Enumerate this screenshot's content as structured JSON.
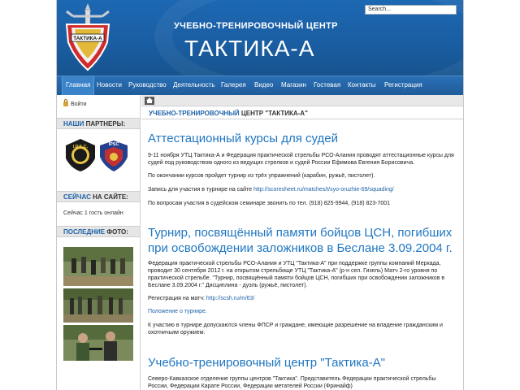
{
  "header": {
    "subtitle": "УЧЕБНО-ТРЕНИРОВОЧНЫЙ ЦЕНТР",
    "title": "ТАКТИКА-А",
    "logo_text": "ТАКТИКА-А",
    "search_placeholder": "Search..."
  },
  "nav": {
    "items": [
      "Главная",
      "Новости",
      "Руководство",
      "Деятельность",
      "Галерея",
      "Видео",
      "Магазин",
      "Гостевая",
      "Контакты",
      "Регистрация"
    ],
    "active": "Главная"
  },
  "sidebar": {
    "login_label": "Войти",
    "partners_title_hl": "НАШИ",
    "partners_title_rest": "ПАРТНЕРЫ:",
    "partner1_text": "I.P.S.C.",
    "partner2_text": "IPSC",
    "online_title_hl": "СЕЙЧАС",
    "online_title_rest": "НА САЙТЕ:",
    "online_text": "Сейчас 1 гость онлайн",
    "photos_title_hl": "ПОСЛЕДНИЕ",
    "photos_title_rest": "ФОТО:"
  },
  "content": {
    "page_label_hl": "УЧЕБНО-ТРЕНИРОВОЧНЫЙ",
    "page_label_rest": "ЦЕНТР \"ТАКТИКА-А\"",
    "articles": [
      {
        "title": "Аттестационный курсы для судей",
        "p1": "9-11 ноября УТЦ Тактика-А и Федерация практической стрельбы РСО-Алания проводят аттестационные курсы для судей под руководством одного из ведущих стрелков и судей России Ефимова Евгения Борисовича.",
        "p2": "По окончании курсов пройдет турнир из трёх упражнений (карабин, ружьё, пистолет).",
        "p3_prefix": "Запись для участия в турнире на сайте",
        "p3_link": "http://scoresheet.ru/matches/t/syo-oruzhie-69/squading/",
        "p4": "По вопросам участия в судейском семинаре звонить по тел. (918) 825-9944, (918) 823-7001"
      },
      {
        "title": "Турнир, посвящённый памяти бойцов ЦСН, погибших при освобождении заложников в Беслане 3.09.2004 г.",
        "p1": "Федерация практической стрельбы РСО-Алания и УТЦ \"Тактика-А\" при поддержке группы компаний Меркада, проводит 30 сентября 2012 г. на открытом стрельбище УТЦ \"Тактика-А\" (р-н сел. Гизель) Матч 2-го уровня по практической стрельбе. \"Турнир, посвящённый памяти бойцов ЦСН, погибших при освобождении заложников в Беслане 3.09.2004 г.\" Дисциплина - дуэль (ружьё, пистолет).",
        "p2_prefix": "Регистрация на матч:",
        "p2_link": "http://scsh.ru/m/63/",
        "p3_link": "Положение о турнире.",
        "p4": "К участию в турнире допускаются члены ФПСР и граждане, имеющие разрешение на владение гражданским и охотничьим оружием."
      },
      {
        "title": "Учебно-тренировочный центр \"Тактика-А\"",
        "p1": "Северо-Кавказское отделение группы центров \"Тактика\". Представитель Федерации практической стрельбы России, Федерации Карате России, Федерации метателей России (Фринайф)"
      }
    ]
  }
}
